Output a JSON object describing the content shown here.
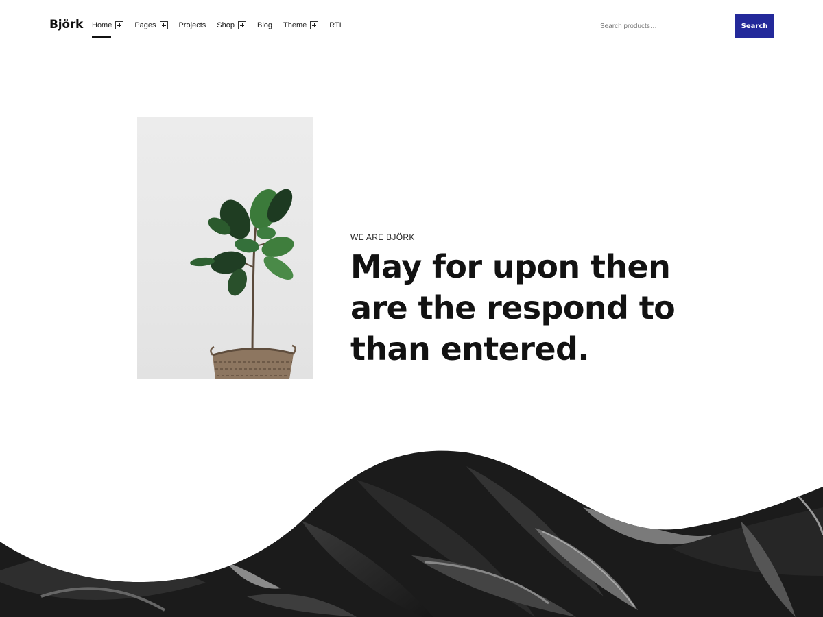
{
  "header": {
    "logo": "Björk",
    "nav": [
      {
        "label": "Home",
        "has_submenu": true,
        "active": true
      },
      {
        "label": "Pages",
        "has_submenu": true
      },
      {
        "label": "Projects",
        "has_submenu": false
      },
      {
        "label": "Shop",
        "has_submenu": true
      },
      {
        "label": "Blog",
        "has_submenu": false
      },
      {
        "label": "Theme",
        "has_submenu": true
      },
      {
        "label": "RTL",
        "has_submenu": false
      }
    ],
    "search": {
      "placeholder": "Search products…",
      "button_label": "Search"
    }
  },
  "hero": {
    "eyebrow": "WE ARE BJÖRK",
    "headline_lines": [
      "May for upon then",
      "are the respond to",
      "than entered."
    ],
    "image_icon": "potted-fiddle-leaf-plant"
  },
  "colors": {
    "accent": "#23299a",
    "text": "#121212",
    "background": "#ffffff"
  }
}
